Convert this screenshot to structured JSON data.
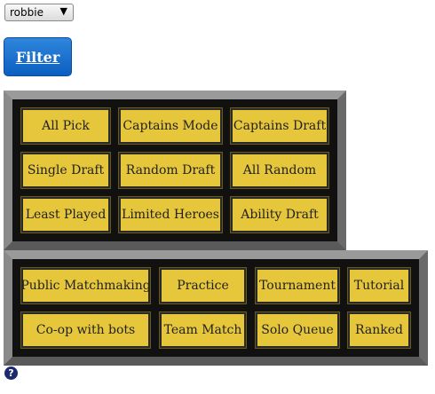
{
  "user_filter": {
    "selected": "robbie",
    "arrow": "▼"
  },
  "filter_button": {
    "label": "Filter"
  },
  "game_modes": [
    "All Pick",
    "Captains Mode",
    "Captains Draft",
    "Single Draft",
    "Random Draft",
    "All Random",
    "Least Played",
    "Limited Heroes",
    "Ability Draft"
  ],
  "lobby_types": [
    "Public Matchmaking",
    "Practice",
    "Tournament",
    "Tutorial",
    "Co-op with bots",
    "Team Match",
    "Solo Queue",
    "Ranked"
  ],
  "help": {
    "symbol": "?"
  },
  "colors": {
    "option_fill": "#e6c63a",
    "panel_fill": "#111111",
    "button_fill": "#0b5fc0"
  }
}
